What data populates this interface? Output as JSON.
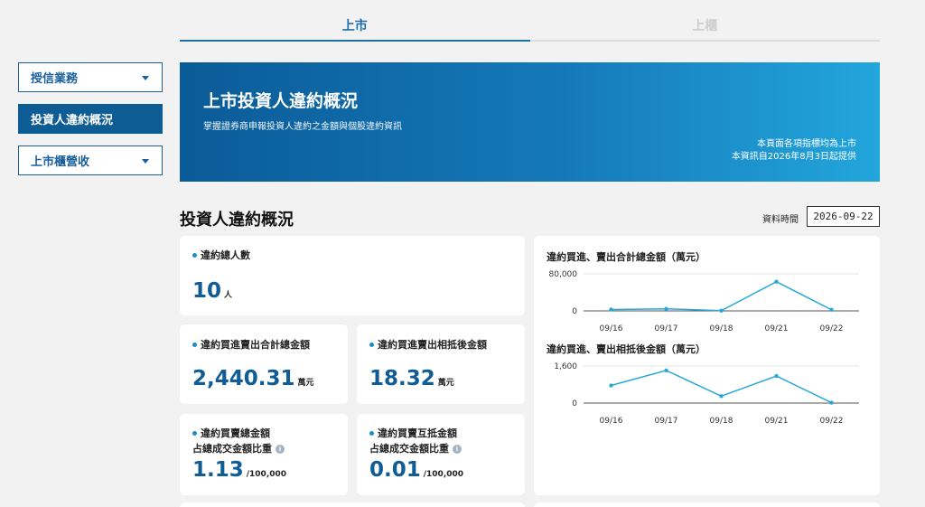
{
  "tabs": [
    {
      "label": "上市",
      "active": true
    },
    {
      "label": "上櫃",
      "active": false
    }
  ],
  "sidebar": {
    "items": [
      {
        "label": "授信業務",
        "has_dropdown": true,
        "active": false
      },
      {
        "label": "投資人違約概況",
        "has_dropdown": false,
        "active": true
      },
      {
        "label": "上市櫃營收",
        "has_dropdown": true,
        "active": false
      }
    ]
  },
  "banner": {
    "title": "上市投資人違約概況",
    "subtitle": "掌握證券商申報投資人違約之金額與個股違約資訊",
    "note_line1": "本頁面各項指標均為上市",
    "note_line2": "本資訊自2026年8月3日起提供"
  },
  "section": {
    "title": "投資人違約概況",
    "date_label": "資料時間",
    "date_value": "2026-09-22"
  },
  "cards": {
    "total_people": {
      "label": "違約總人數",
      "value": "10",
      "unit": "人"
    },
    "total_amount": {
      "label": "違約買進賣出合計總金額",
      "value": "2,440.31",
      "unit": "萬元"
    },
    "net_amount": {
      "label": "違約買進賣出相抵後金額",
      "value": "18.32",
      "unit": "萬元"
    },
    "ratio_total": {
      "label_line1": "違約買賣總金額",
      "label_line2": "占總成交金額比重",
      "value": "1.13",
      "unit": "/100,000",
      "info_icon": "info-icon"
    },
    "ratio_net": {
      "label_line1": "違約買賣互抵金額",
      "label_line2": "占總成交金額比重",
      "value": "0.01",
      "unit": "/100,000",
      "info_icon": "info-icon"
    }
  },
  "chart_data": [
    {
      "type": "line",
      "title": "違約買進、賣出合計總金額（萬元）",
      "categories": [
        "09/16",
        "09/17",
        "09/18",
        "09/21",
        "09/22"
      ],
      "values": [
        3000,
        4500,
        500,
        63000,
        2440
      ],
      "yticks": [
        0,
        80000
      ],
      "ylim": [
        0,
        80000
      ],
      "color": "#29a8d8",
      "grid": true
    },
    {
      "type": "line",
      "title": "違約買進、賣出相抵後金額（萬元）",
      "categories": [
        "09/16",
        "09/17",
        "09/18",
        "09/21",
        "09/22"
      ],
      "values": [
        760,
        1410,
        300,
        1170,
        18
      ],
      "yticks": [
        0,
        1600
      ],
      "ylim": [
        0,
        1600
      ],
      "color": "#29a8d8",
      "grid": true
    }
  ]
}
